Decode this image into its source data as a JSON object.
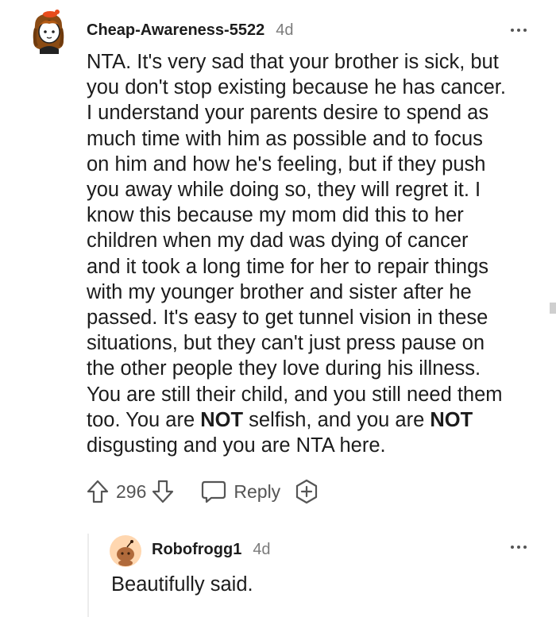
{
  "comment": {
    "author": "Cheap-Awareness-5522",
    "age": "4d",
    "body": {
      "l1": "NTA. It's very sad that your brother is sick, but",
      "l2": "you don't stop existing because he has cancer.",
      "l3": "I understand your parents desire to spend as",
      "l4": "much time with him as possible and to focus",
      "l5": "on him and how he's feeling, but if they push",
      "l6": "you away while doing so, they will regret it. I",
      "l7": "know this because my mom did this to her",
      "l8": "children when my dad was dying of cancer",
      "l9": "and it took a long time for her to repair things",
      "l10": "with my younger brother and sister after he",
      "l11": "passed. It's easy to get tunnel vision in these",
      "l12": "situations, but they can't just press pause on",
      "l13": "the other people they love during his illness.",
      "l14": "You are still their child, and you still need them",
      "l15a": "too. You are ",
      "l15b": "NOT",
      "l15c": " selfish, and you are ",
      "l15d": "NOT",
      "l16": "disgusting and you are NTA here."
    },
    "actions": {
      "votes": "296",
      "reply_label": "Reply"
    }
  },
  "reply": {
    "author": "Robofrogg1",
    "age": "4d",
    "body": "Beautifully said."
  },
  "icons": {
    "upvote": "arrow-up-outline-icon",
    "downvote": "arrow-down-outline-icon",
    "reply": "speech-bubble-icon",
    "award": "hexagon-plus-icon",
    "more": "three-dots-icon"
  },
  "colors": {
    "text": "#1c1c1c",
    "muted": "#7c7c7c",
    "icon": "#555555",
    "thread_line": "#ececec"
  }
}
